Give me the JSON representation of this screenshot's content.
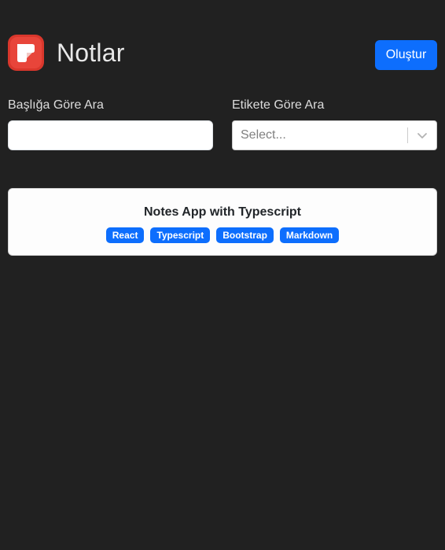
{
  "header": {
    "title": "Notlar",
    "logo_icon": "notes-app-logo-icon",
    "create_label": "Oluştur"
  },
  "filters": {
    "title_search": {
      "label": "Başlığa Göre Ara",
      "value": "",
      "placeholder": ""
    },
    "tag_select": {
      "label": "Etikete Göre Ara",
      "placeholder": "Select...",
      "chevron_icon": "chevron-down-icon"
    }
  },
  "notes": [
    {
      "title": "Notes App with Typescript",
      "tags": [
        "React",
        "Typescript",
        "Bootstrap",
        "Markdown"
      ]
    }
  ],
  "colors": {
    "background": "#212121",
    "primary": "#0d6efd",
    "logo_red": "#e53935"
  }
}
